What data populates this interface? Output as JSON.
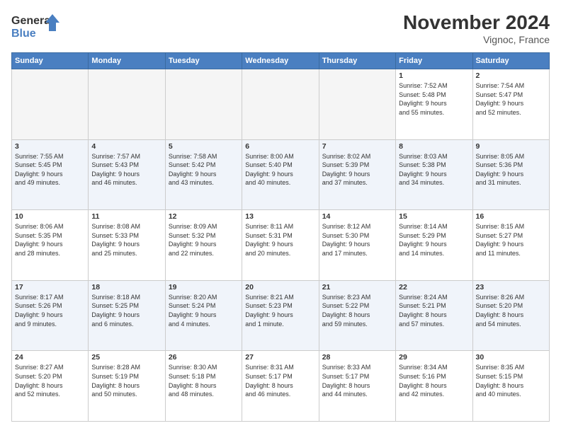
{
  "header": {
    "logo_line1": "General",
    "logo_line2": "Blue",
    "month": "November 2024",
    "location": "Vignoc, France"
  },
  "weekdays": [
    "Sunday",
    "Monday",
    "Tuesday",
    "Wednesday",
    "Thursday",
    "Friday",
    "Saturday"
  ],
  "weeks": [
    [
      {
        "day": "",
        "info": ""
      },
      {
        "day": "",
        "info": ""
      },
      {
        "day": "",
        "info": ""
      },
      {
        "day": "",
        "info": ""
      },
      {
        "day": "",
        "info": ""
      },
      {
        "day": "1",
        "info": "Sunrise: 7:52 AM\nSunset: 5:48 PM\nDaylight: 9 hours\nand 55 minutes."
      },
      {
        "day": "2",
        "info": "Sunrise: 7:54 AM\nSunset: 5:47 PM\nDaylight: 9 hours\nand 52 minutes."
      }
    ],
    [
      {
        "day": "3",
        "info": "Sunrise: 7:55 AM\nSunset: 5:45 PM\nDaylight: 9 hours\nand 49 minutes."
      },
      {
        "day": "4",
        "info": "Sunrise: 7:57 AM\nSunset: 5:43 PM\nDaylight: 9 hours\nand 46 minutes."
      },
      {
        "day": "5",
        "info": "Sunrise: 7:58 AM\nSunset: 5:42 PM\nDaylight: 9 hours\nand 43 minutes."
      },
      {
        "day": "6",
        "info": "Sunrise: 8:00 AM\nSunset: 5:40 PM\nDaylight: 9 hours\nand 40 minutes."
      },
      {
        "day": "7",
        "info": "Sunrise: 8:02 AM\nSunset: 5:39 PM\nDaylight: 9 hours\nand 37 minutes."
      },
      {
        "day": "8",
        "info": "Sunrise: 8:03 AM\nSunset: 5:38 PM\nDaylight: 9 hours\nand 34 minutes."
      },
      {
        "day": "9",
        "info": "Sunrise: 8:05 AM\nSunset: 5:36 PM\nDaylight: 9 hours\nand 31 minutes."
      }
    ],
    [
      {
        "day": "10",
        "info": "Sunrise: 8:06 AM\nSunset: 5:35 PM\nDaylight: 9 hours\nand 28 minutes."
      },
      {
        "day": "11",
        "info": "Sunrise: 8:08 AM\nSunset: 5:33 PM\nDaylight: 9 hours\nand 25 minutes."
      },
      {
        "day": "12",
        "info": "Sunrise: 8:09 AM\nSunset: 5:32 PM\nDaylight: 9 hours\nand 22 minutes."
      },
      {
        "day": "13",
        "info": "Sunrise: 8:11 AM\nSunset: 5:31 PM\nDaylight: 9 hours\nand 20 minutes."
      },
      {
        "day": "14",
        "info": "Sunrise: 8:12 AM\nSunset: 5:30 PM\nDaylight: 9 hours\nand 17 minutes."
      },
      {
        "day": "15",
        "info": "Sunrise: 8:14 AM\nSunset: 5:29 PM\nDaylight: 9 hours\nand 14 minutes."
      },
      {
        "day": "16",
        "info": "Sunrise: 8:15 AM\nSunset: 5:27 PM\nDaylight: 9 hours\nand 11 minutes."
      }
    ],
    [
      {
        "day": "17",
        "info": "Sunrise: 8:17 AM\nSunset: 5:26 PM\nDaylight: 9 hours\nand 9 minutes."
      },
      {
        "day": "18",
        "info": "Sunrise: 8:18 AM\nSunset: 5:25 PM\nDaylight: 9 hours\nand 6 minutes."
      },
      {
        "day": "19",
        "info": "Sunrise: 8:20 AM\nSunset: 5:24 PM\nDaylight: 9 hours\nand 4 minutes."
      },
      {
        "day": "20",
        "info": "Sunrise: 8:21 AM\nSunset: 5:23 PM\nDaylight: 9 hours\nand 1 minute."
      },
      {
        "day": "21",
        "info": "Sunrise: 8:23 AM\nSunset: 5:22 PM\nDaylight: 8 hours\nand 59 minutes."
      },
      {
        "day": "22",
        "info": "Sunrise: 8:24 AM\nSunset: 5:21 PM\nDaylight: 8 hours\nand 57 minutes."
      },
      {
        "day": "23",
        "info": "Sunrise: 8:26 AM\nSunset: 5:20 PM\nDaylight: 8 hours\nand 54 minutes."
      }
    ],
    [
      {
        "day": "24",
        "info": "Sunrise: 8:27 AM\nSunset: 5:20 PM\nDaylight: 8 hours\nand 52 minutes."
      },
      {
        "day": "25",
        "info": "Sunrise: 8:28 AM\nSunset: 5:19 PM\nDaylight: 8 hours\nand 50 minutes."
      },
      {
        "day": "26",
        "info": "Sunrise: 8:30 AM\nSunset: 5:18 PM\nDaylight: 8 hours\nand 48 minutes."
      },
      {
        "day": "27",
        "info": "Sunrise: 8:31 AM\nSunset: 5:17 PM\nDaylight: 8 hours\nand 46 minutes."
      },
      {
        "day": "28",
        "info": "Sunrise: 8:33 AM\nSunset: 5:17 PM\nDaylight: 8 hours\nand 44 minutes."
      },
      {
        "day": "29",
        "info": "Sunrise: 8:34 AM\nSunset: 5:16 PM\nDaylight: 8 hours\nand 42 minutes."
      },
      {
        "day": "30",
        "info": "Sunrise: 8:35 AM\nSunset: 5:15 PM\nDaylight: 8 hours\nand 40 minutes."
      }
    ]
  ]
}
